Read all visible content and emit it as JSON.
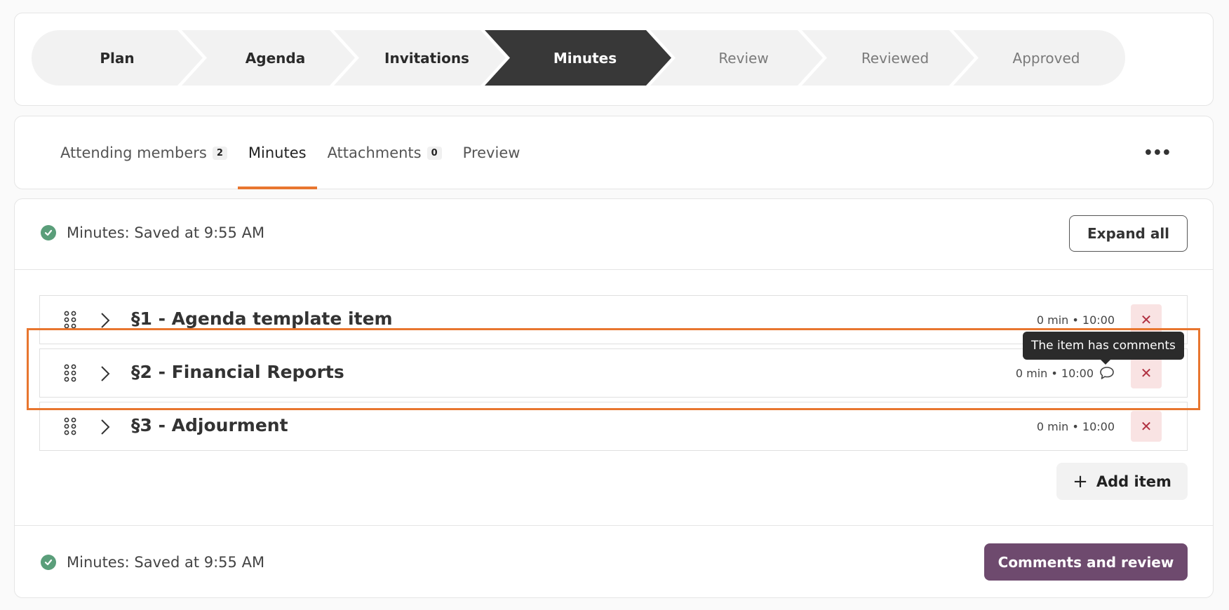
{
  "stepper": {
    "steps": [
      {
        "label": "Plan"
      },
      {
        "label": "Agenda"
      },
      {
        "label": "Invitations"
      },
      {
        "label": "Minutes"
      },
      {
        "label": "Review"
      },
      {
        "label": "Reviewed"
      },
      {
        "label": "Approved"
      }
    ]
  },
  "tabs": {
    "items": [
      {
        "label": "Attending members",
        "badge": "2"
      },
      {
        "label": "Minutes"
      },
      {
        "label": "Attachments",
        "badge": "0"
      },
      {
        "label": "Preview"
      }
    ],
    "more_label": "•••"
  },
  "minutes": {
    "save_status_top": "Minutes: Saved at 9:55 AM",
    "expand_all_label": "Expand all",
    "items": [
      {
        "title": "§1 - Agenda template item",
        "meta": "0 min • 10:00",
        "remove": "✕"
      },
      {
        "title": "§2 - Financial Reports",
        "meta": "0 min • 10:00",
        "remove": "✕"
      },
      {
        "title": "§3 - Adjourment",
        "meta": "0 min • 10:00",
        "remove": "✕"
      }
    ],
    "tooltip": "The item has comments",
    "add_item_label": "Add item",
    "add_item_icon": "+",
    "save_status_bottom": "Minutes: Saved at 9:55 AM",
    "comments_review_label": "Comments and review"
  },
  "colors": {
    "accent": "#e8762f",
    "active_step": "#383838",
    "primary_button": "#6e4a6e",
    "success": "#5a9e7a"
  }
}
